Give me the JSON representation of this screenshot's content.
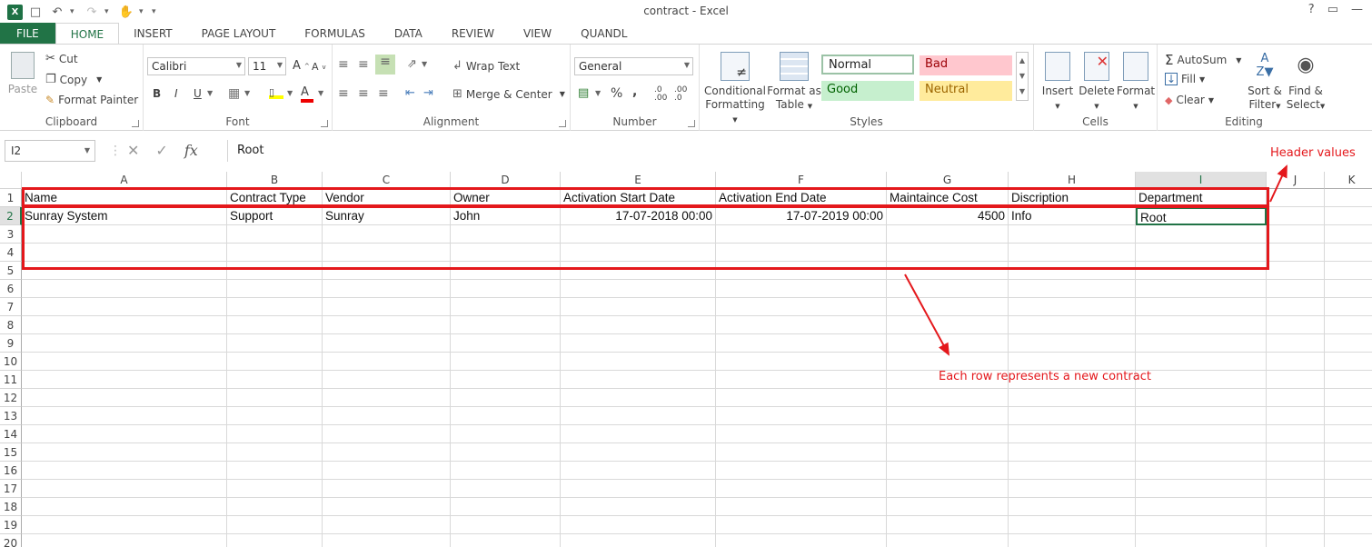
{
  "app": {
    "title": "contract - Excel",
    "help": "?",
    "win_controls": [
      "▭",
      "—"
    ]
  },
  "tabs": [
    "FILE",
    "HOME",
    "INSERT",
    "PAGE LAYOUT",
    "FORMULAS",
    "DATA",
    "REVIEW",
    "VIEW",
    "QUANDL"
  ],
  "ribbon": {
    "clipboard": {
      "paste": "Paste",
      "cut": "Cut",
      "copy": "Copy",
      "format_painter": "Format Painter",
      "label": "Clipboard"
    },
    "font": {
      "name": "Calibri",
      "size": "11",
      "bold": "B",
      "italic": "I",
      "underline": "U",
      "label": "Font"
    },
    "alignment": {
      "wrap": "Wrap Text",
      "merge": "Merge & Center",
      "label": "Alignment"
    },
    "number": {
      "format": "General",
      "percent": "%",
      "comma": ",",
      "label": "Number"
    },
    "styles": {
      "conditional_line1": "Conditional",
      "conditional_line2": "Formatting",
      "table_line1": "Format as",
      "table_line2": "Table",
      "normal": "Normal",
      "bad": "Bad",
      "good": "Good",
      "neutral": "Neutral",
      "label": "Styles"
    },
    "cells": {
      "insert": "Insert",
      "delete": "Delete",
      "format": "Format",
      "label": "Cells"
    },
    "editing": {
      "autosum": "AutoSum",
      "fill": "Fill",
      "clear": "Clear",
      "sort_line1": "Sort &",
      "sort_line2": "Filter",
      "find_line1": "Find &",
      "find_line2": "Select",
      "label": "Editing"
    }
  },
  "formula_bar": {
    "name_box": "I2",
    "fx": "fx",
    "content": "Root"
  },
  "sheet": {
    "columns": [
      "A",
      "B",
      "C",
      "D",
      "E",
      "F",
      "G",
      "H",
      "I",
      "J",
      "K"
    ],
    "rows": [
      "1",
      "2",
      "3",
      "4",
      "5",
      "6",
      "7",
      "8",
      "9",
      "10",
      "11",
      "12",
      "13",
      "14",
      "15",
      "16",
      "17",
      "18",
      "19",
      "20"
    ],
    "header_row": [
      "Name",
      "Contract Type",
      "Vendor",
      "Owner",
      "Activation Start Date",
      "Activation End Date",
      "Maintaince Cost",
      "Discription",
      "Department"
    ],
    "data_row": [
      "Sunray System",
      "Support",
      "Sunray",
      "John",
      "17-07-2018 00:00",
      "17-07-2019 00:00",
      "4500",
      "Info",
      "Root"
    ]
  },
  "annotations": {
    "header_note": "Header values",
    "row_note": "Each row represents a new contract"
  }
}
